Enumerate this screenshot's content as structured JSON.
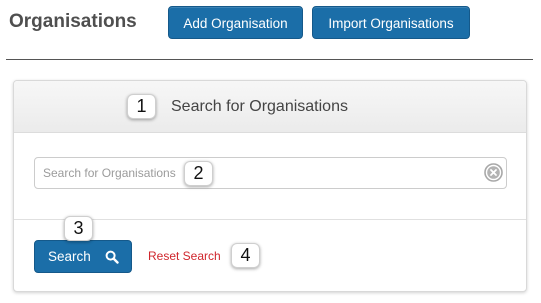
{
  "header": {
    "title": "Organisations",
    "add_button": "Add Organisation",
    "import_button": "Import Organisations"
  },
  "panel": {
    "title": "Search for Organisations",
    "search_placeholder": "Search for Organisations",
    "search_value": "",
    "search_button": "Search",
    "reset_link": "Reset Search"
  },
  "badges": [
    "1",
    "2",
    "3",
    "4"
  ],
  "icons": {
    "clear": "clear-circle-x-icon",
    "search": "magnifier-icon"
  },
  "colors": {
    "primary": "#1b6ea8",
    "reset_link": "#d0262d",
    "title": "#4f4f4f"
  }
}
